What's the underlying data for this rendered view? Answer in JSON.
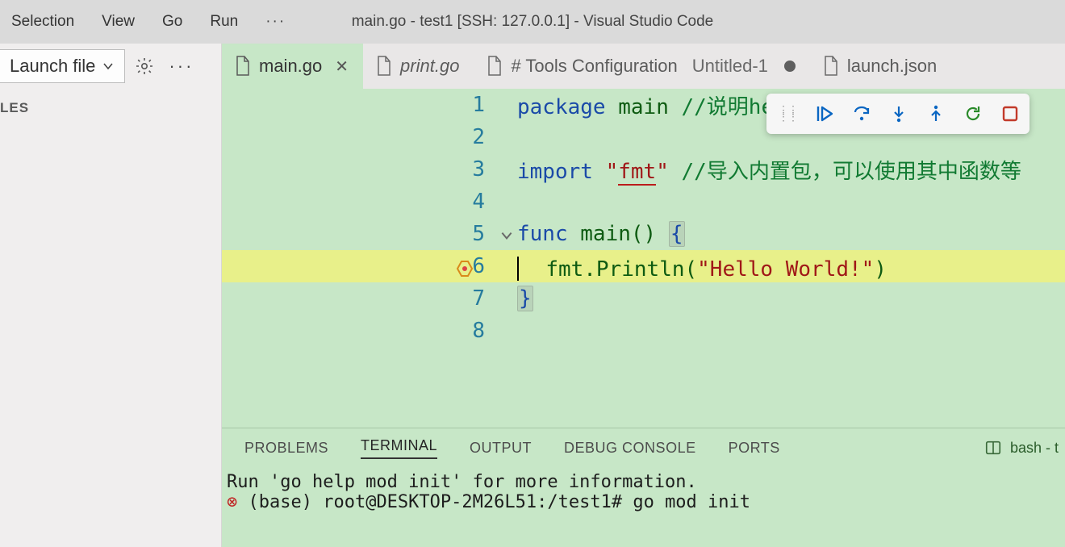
{
  "menubar": {
    "items": [
      "Selection",
      "View",
      "Go",
      "Run"
    ],
    "title": "main.go - test1 [SSH: 127.0.0.1] - Visual Studio Code"
  },
  "sidebar": {
    "launch_label": "Launch file",
    "section_label": "LES"
  },
  "tabs": [
    {
      "name": "main.go",
      "active": true,
      "italic": false,
      "close": true
    },
    {
      "name": "print.go",
      "active": false,
      "italic": true,
      "close": false
    },
    {
      "name": "# Tools Configuration",
      "untitled": "Untitled-1",
      "active": false,
      "italic": false,
      "dirty": true
    },
    {
      "name": "launch.json",
      "active": false,
      "italic": false,
      "close": false
    }
  ],
  "code": {
    "line_numbers": [
      "1",
      "2",
      "3",
      "4",
      "5",
      "6",
      "7",
      "8"
    ],
    "tokens": {
      "l1_kw": "package",
      "l1_id": " main ",
      "l1_cm": "//说明hello.go这个文件",
      "l3_kw": "import",
      "l3_sp": " ",
      "l3_q1": "\"",
      "l3_pkg": "fmt",
      "l3_q2": "\"",
      "l3_sp2": " ",
      "l3_cm": "//导入内置包，可以使用其中函数等",
      "l5_kw": "func",
      "l5_id": " main() ",
      "l5_br": "{",
      "l6_indent": "  ",
      "l6_call": "fmt.Println(",
      "l6_str": "\"Hello World!\"",
      "l6_end": ")",
      "l7_br": "}"
    }
  },
  "panel": {
    "tabs": [
      "PROBLEMS",
      "TERMINAL",
      "OUTPUT",
      "DEBUG CONSOLE",
      "PORTS"
    ],
    "right_label": "bash - t",
    "terminal": {
      "line1": "Run 'go help mod init' for more information.",
      "line2_prompt": "(base) root@DESKTOP-2M26L51:/test1# ",
      "line2_cmd": "go mod init"
    }
  },
  "debug_toolbar": {
    "buttons": [
      "continue",
      "step-over",
      "step-into",
      "step-out",
      "restart",
      "stop"
    ]
  }
}
